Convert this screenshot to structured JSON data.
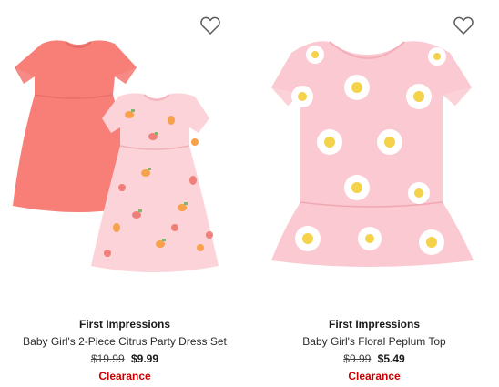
{
  "products": [
    {
      "brand": "First Impressions",
      "name": "Baby Girl's 2-Piece Citrus Party Dress Set",
      "original_price": "$19.99",
      "sale_price": "$9.99",
      "badge": "Clearance",
      "wishlist_icon": "heart-outline-icon"
    },
    {
      "brand": "First Impressions",
      "name": "Baby Girl's Floral Peplum Top",
      "original_price": "$9.99",
      "sale_price": "$5.49",
      "badge": "Clearance",
      "wishlist_icon": "heart-outline-icon"
    }
  ],
  "colors": {
    "coral_dress": "#f87e78",
    "pink_dress": "#fbd3d8",
    "pink_top": "#fbc9d1",
    "clearance_red": "#cc0000"
  }
}
